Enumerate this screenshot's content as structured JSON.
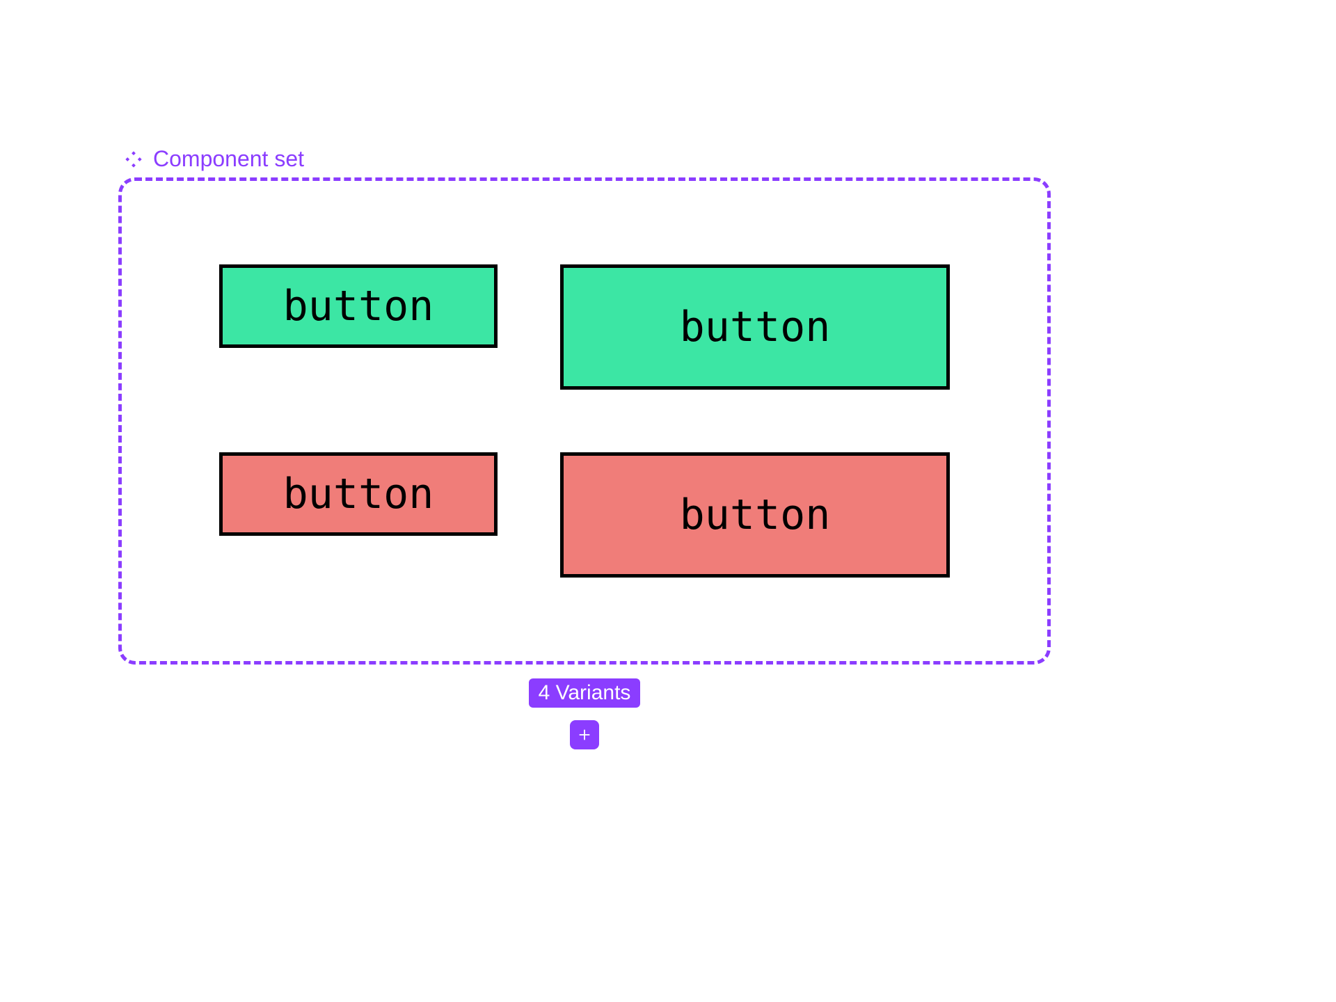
{
  "header": {
    "title": "Component set",
    "icon": "component-set-icon"
  },
  "variants": {
    "small_green": {
      "label": "button"
    },
    "large_green": {
      "label": "button"
    },
    "small_red": {
      "label": "button"
    },
    "large_red": {
      "label": "button"
    }
  },
  "footer": {
    "badge": "4 Variants"
  },
  "colors": {
    "purple": "#8b3dff",
    "green": "#3ce6a4",
    "red": "#f07d79"
  }
}
